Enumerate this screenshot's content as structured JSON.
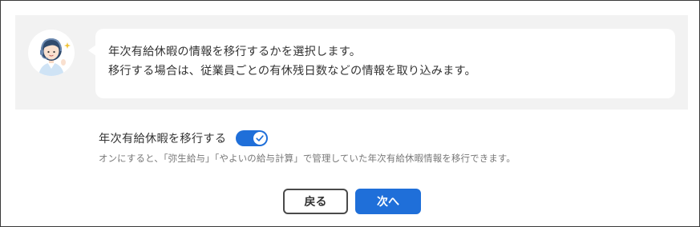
{
  "banner": {
    "avatar_icon": "support-operator-avatar",
    "message_lines": [
      "年次有給休暇の情報を移行するかを選択します。",
      "移行する場合は、従業員ごとの有休残日数などの情報を取り込みます。"
    ]
  },
  "setting": {
    "label": "年次有給休暇を移行する",
    "toggle_on": true,
    "description": "オンにすると、「弥生給与」「やよいの給与計算」で管理していた年次有給休暇情報を移行できます。"
  },
  "buttons": {
    "back_label": "戻る",
    "next_label": "次へ"
  },
  "colors": {
    "accent": "#1f6fd9",
    "banner_bg": "#f2f2f2"
  }
}
